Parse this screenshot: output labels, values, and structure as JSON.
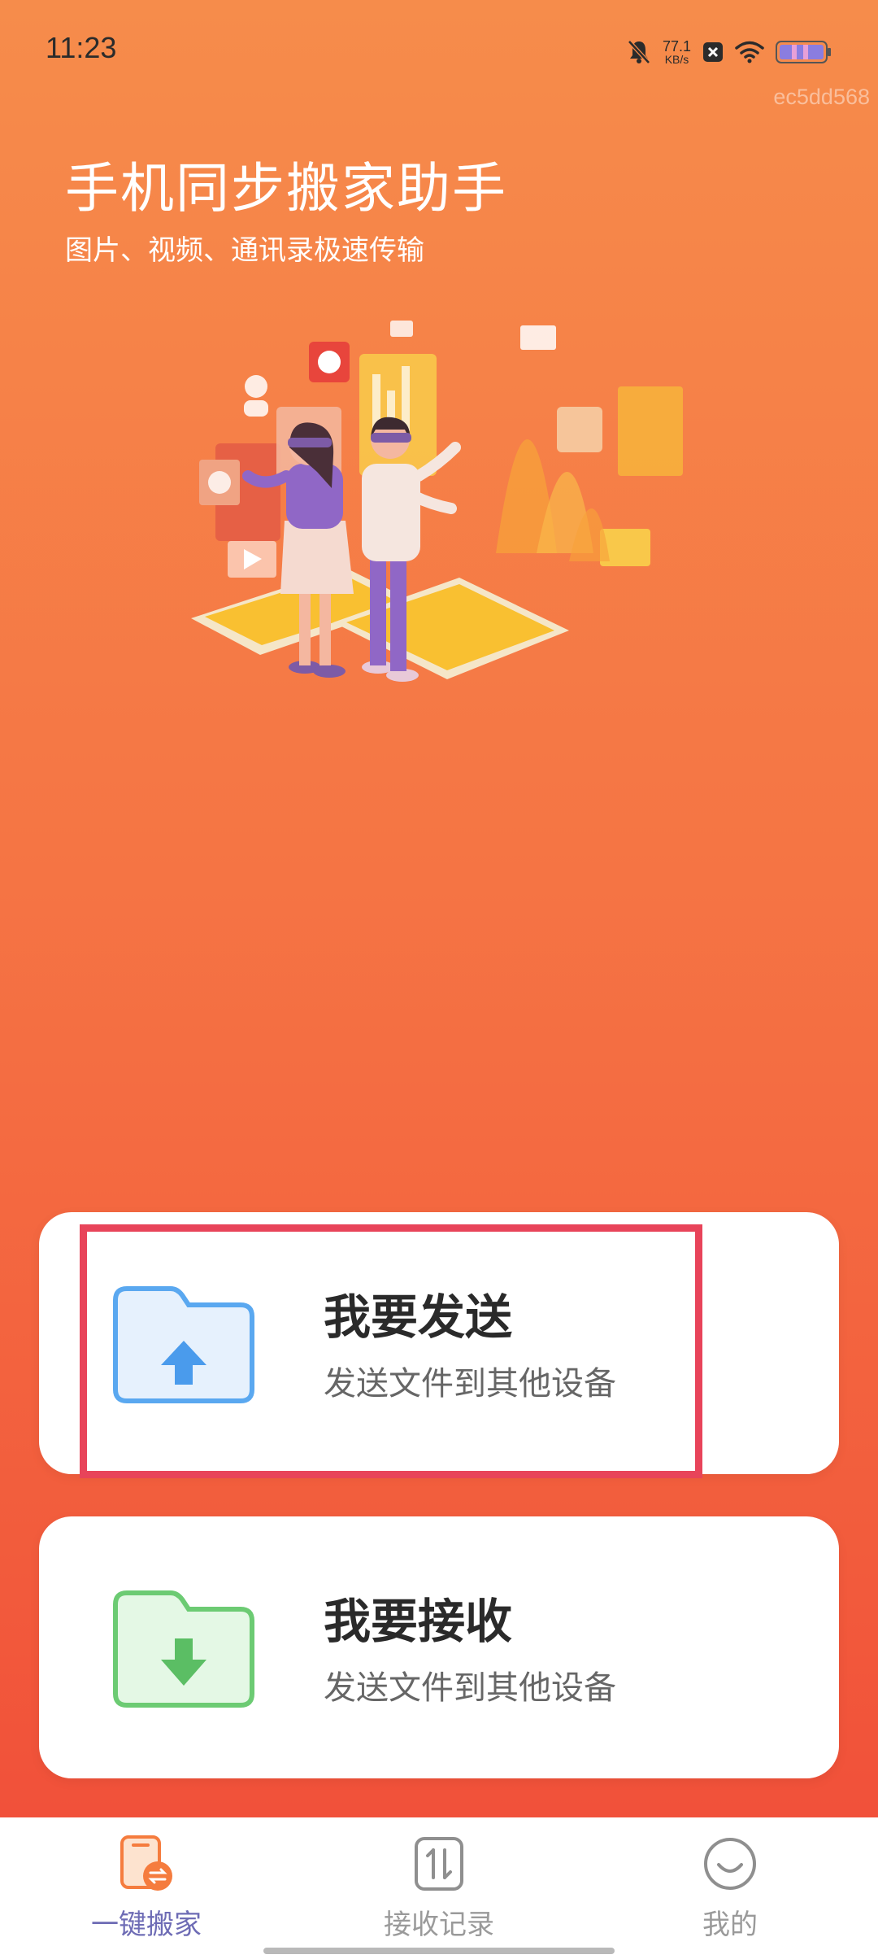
{
  "status_bar": {
    "time": "11:23",
    "net_speed_value": "77.1",
    "net_speed_unit": "KB/s",
    "icons": [
      "bell-muted-icon",
      "blocked-icon",
      "wifi-icon",
      "battery-icon"
    ]
  },
  "watermark": "ec5dd568",
  "header": {
    "title": "手机同步搬家助手",
    "subtitle": "图片、视频、通讯录极速传输"
  },
  "illustration": {
    "icon": "people-transfer-illustration"
  },
  "cards": [
    {
      "title": "我要发送",
      "desc": "发送文件到其他设备",
      "icon": "folder-upload-icon",
      "color": "#5AA8F0"
    },
    {
      "title": "我要接收",
      "desc": "发送文件到其他设备",
      "icon": "folder-download-icon",
      "color": "#6CCB73"
    }
  ],
  "nav": {
    "items": [
      {
        "label": "一键搬家",
        "icon": "phone-transfer-icon",
        "active": true
      },
      {
        "label": "接收记录",
        "icon": "transfer-records-icon",
        "active": false
      },
      {
        "label": "我的",
        "icon": "smile-profile-icon",
        "active": false
      }
    ]
  },
  "colors": {
    "background_top": "#F68C4B",
    "background_bottom": "#F04B38",
    "highlight": "#E8445A",
    "nav_active": "#6E6CB5",
    "nav_inactive": "#9a9a9a"
  }
}
